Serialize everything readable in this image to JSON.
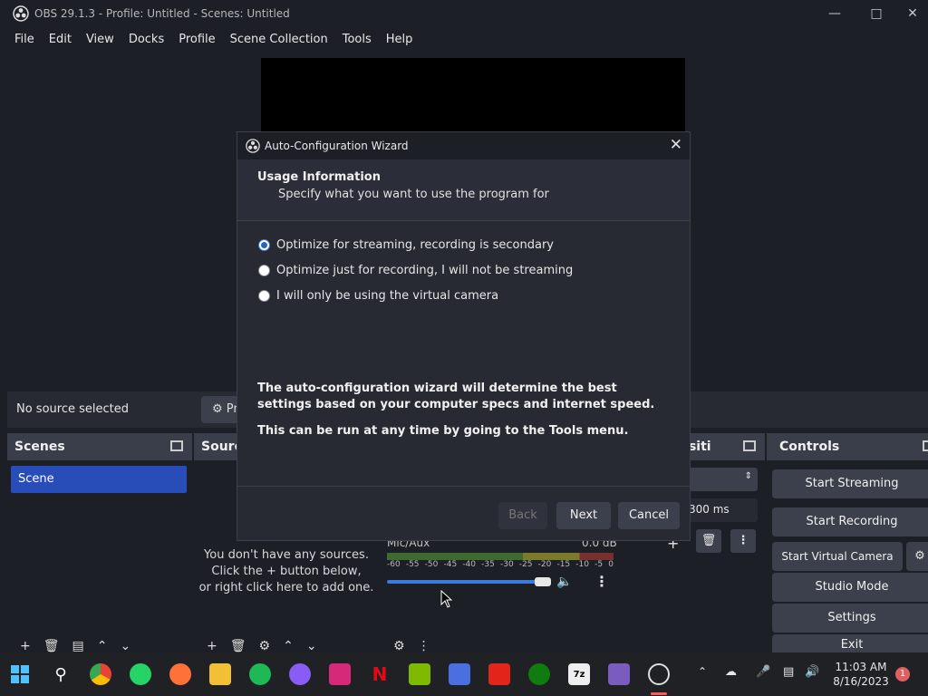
{
  "window": {
    "title": "OBS 29.1.3 - Profile: Untitled - Scenes: Untitled"
  },
  "menu": [
    "File",
    "Edit",
    "View",
    "Docks",
    "Profile",
    "Scene Collection",
    "Tools",
    "Help"
  ],
  "source_bar": {
    "status": "No source selected",
    "properties_label": "Pr"
  },
  "scenes": {
    "title": "Scenes",
    "items": [
      "Scene"
    ]
  },
  "sources": {
    "title": "Sourc",
    "empty_text": [
      "You don't have any sources.",
      "Click the + button below,",
      "or right click here to add one."
    ]
  },
  "mixer": {
    "channel": "Mic/Aux",
    "level": "0.0 dB",
    "scale": [
      "-60",
      "-55",
      "-50",
      "-45",
      "-40",
      "-35",
      "-30",
      "-25",
      "-20",
      "-15",
      "-10",
      "-5",
      "0"
    ]
  },
  "transitions": {
    "title": "nsiti",
    "duration": "300 ms"
  },
  "controls": {
    "title": "Controls",
    "buttons": [
      "Start Streaming",
      "Start Recording",
      "Start Virtual Camera",
      "Studio Mode",
      "Settings",
      "Exit"
    ]
  },
  "dialog": {
    "title": "Auto-Configuration Wizard",
    "heading": "Usage Information",
    "subheading": "Specify what you want to use the program for",
    "options": [
      {
        "label": "Optimize for streaming, recording is secondary",
        "selected": true
      },
      {
        "label": "Optimize just for recording, I will not be streaming",
        "selected": false
      },
      {
        "label": "I will only be using the virtual camera",
        "selected": false
      }
    ],
    "info1": "The auto-configuration wizard will determine the best settings based on your computer specs and internet speed.",
    "info2": "This can be run at any time by going to the Tools menu.",
    "back": "Back",
    "next": "Next",
    "cancel": "Cancel"
  },
  "taskbar": {
    "time": "11:03 AM",
    "date": "8/16/2023",
    "notifications": "1"
  },
  "colors": {
    "accent": "#284cb8",
    "panel": "#272a33",
    "background": "#1d1f26"
  }
}
